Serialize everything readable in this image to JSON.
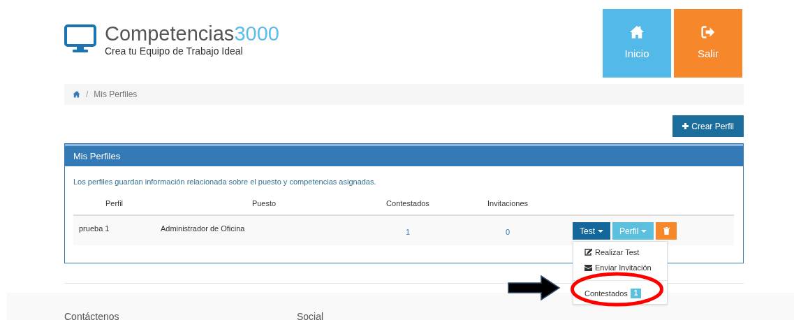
{
  "brand": {
    "name": "Competencias",
    "number": "3000",
    "tagline": "Crea tu Equipo de Trabajo Ideal"
  },
  "nav_tiles": [
    {
      "label": "Inicio",
      "kind": "home"
    },
    {
      "label": "Salir",
      "kind": "exit"
    }
  ],
  "breadcrumb": {
    "separator": "/",
    "items": [
      "Mis Perfiles"
    ]
  },
  "create_button": "Crear Perfil",
  "panel": {
    "title": "Mis Perfiles",
    "description": "Los perfiles guardan información relacionada sobre el puesto y competencias asignadas.",
    "table": {
      "columns": [
        "Perfil",
        "Puesto",
        "Contestados",
        "Invitaciones"
      ],
      "rows": [
        {
          "perfil": "prueba 1",
          "puesto": "Administrador de Oficina",
          "contestados": "1",
          "invitaciones": "0",
          "test_button": "Test",
          "perfil_button": "Perfil",
          "menu_open": true
        }
      ]
    }
  },
  "menu": [
    {
      "kind": "edit",
      "label": "Realizar Test"
    },
    {
      "kind": "invite",
      "label": "Enviar Invitación"
    },
    {
      "kind": "divider"
    },
    {
      "kind": "count",
      "label": "Contestados",
      "badge": "1"
    }
  ],
  "footer": [
    "Contáctenos",
    "Social"
  ]
}
